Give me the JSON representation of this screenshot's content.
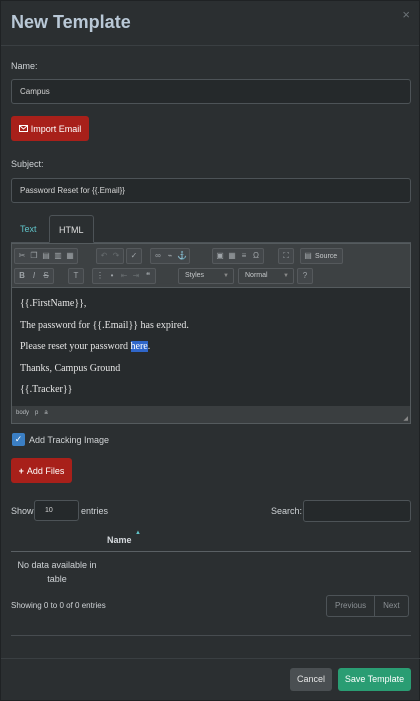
{
  "modal": {
    "title": "New Template",
    "close": "×"
  },
  "name_field": {
    "label": "Name:",
    "value": "Campus"
  },
  "import_button": {
    "icon": "envelope-icon",
    "label": "Import Email"
  },
  "subject_field": {
    "label": "Subject:",
    "value": "Password Reset for {{.Email}}"
  },
  "tabs": [
    {
      "label": "Text"
    },
    {
      "label": "HTML"
    }
  ],
  "editor": {
    "toolbar": {
      "source_label": "Source",
      "styles": "Styles",
      "format": "Normal"
    },
    "lines": {
      "l1": "{{.FirstName}},",
      "l2": "The password for {{.Email}} has expired.",
      "l3_pre": "Please reset your password ",
      "l3_link": "here",
      "l3_post": ".",
      "l4": "Thanks, Campus Ground",
      "l5": "{{.Tracker}}"
    },
    "path": [
      "body",
      "p",
      "a"
    ]
  },
  "tracking": {
    "label": "Add Tracking Image",
    "checked": true
  },
  "add_files": {
    "label": "Add Files"
  },
  "table": {
    "show_label": "Show",
    "length": "10",
    "entries_label": "entries",
    "search_label": "Search:",
    "column": "Name",
    "empty": "No data available in table",
    "info": "Showing 0 to 0 of 0 entries",
    "prev": "Previous",
    "next": "Next"
  },
  "footer": {
    "cancel": "Cancel",
    "save": "Save Template"
  },
  "colors": {
    "primary": "#a8201a",
    "success": "#2a9d73",
    "accent": "#5fc3c8",
    "background": "#2b2f31"
  }
}
